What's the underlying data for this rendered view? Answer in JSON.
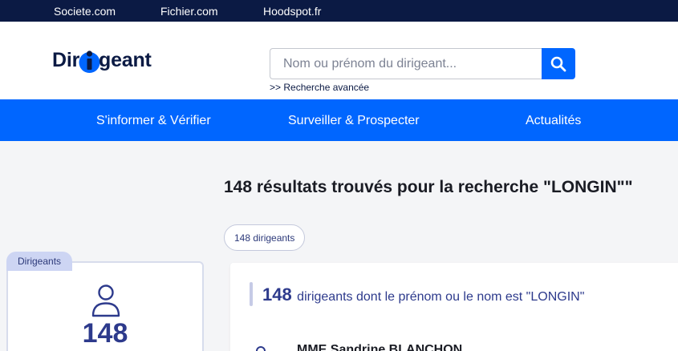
{
  "topbar": {
    "links": [
      "Societe.com",
      "Fichier.com",
      "Hoodspot.fr"
    ]
  },
  "header": {
    "logo_text_before": "Dir",
    "logo_text_after": "geant",
    "search": {
      "placeholder": "Nom ou prénom du dirigeant...",
      "button_icon": "search-icon"
    },
    "advanced_search": ">> Recherche avancée"
  },
  "nav": {
    "items": [
      "S'informer & Vérifier",
      "Surveiller & Prospecter",
      "Actualités"
    ]
  },
  "results": {
    "title": "148 résultats trouvés pour la recherche \"LONGIN\"\"",
    "chip": "148 dirigeants"
  },
  "sidebar": {
    "tab_label": "Dirigeants",
    "icon": "user-icon",
    "count": "148"
  },
  "main": {
    "section_count": "148",
    "section_text": "dirigeants dont le prénom ou le nom est \"LONGIN\"",
    "first_row": {
      "icon": "user-icon",
      "name": "MME Sandrine BLANCHON"
    }
  },
  "colors": {
    "topbar": "#0b1a44",
    "accent": "#0066ff",
    "primary_text": "#2d3a8c",
    "page_background": "#f4f5f7"
  }
}
